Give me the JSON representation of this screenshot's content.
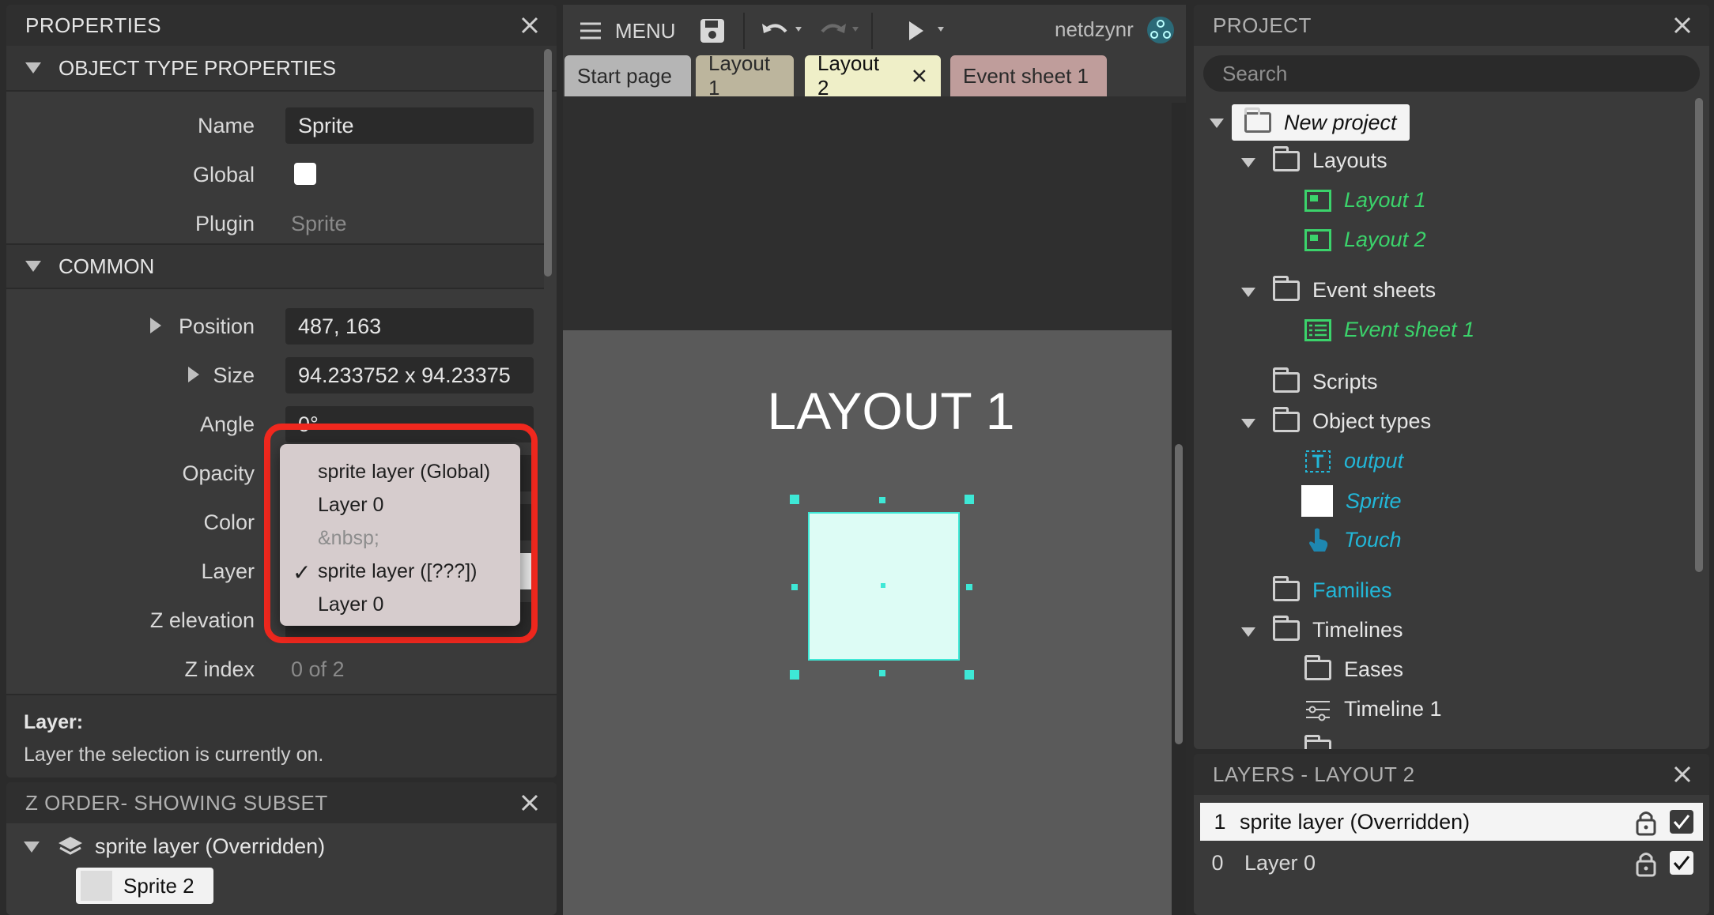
{
  "properties": {
    "title": "PROPERTIES",
    "object_type_section": "OBJECT TYPE PROPERTIES",
    "name_label": "Name",
    "name_value": "Sprite",
    "global_label": "Global",
    "plugin_label": "Plugin",
    "plugin_value": "Sprite",
    "common_section": "COMMON",
    "position_label": "Position",
    "position_value": "487, 163",
    "size_label": "Size",
    "size_value": "94.233752 x 94.23375",
    "angle_label": "Angle",
    "angle_value": "0°",
    "opacity_label": "Opacity",
    "color_label": "Color",
    "layer_label": "Layer",
    "z_elevation_label": "Z elevation",
    "z_index_label": "Z index",
    "z_index_value": "0 of 2",
    "desc_title": "Layer:",
    "desc_text": "Layer the selection is currently on."
  },
  "layer_dropdown": {
    "options": [
      {
        "label": "sprite layer (Global)",
        "checked": false,
        "disabled": false
      },
      {
        "label": "Layer 0",
        "checked": false,
        "disabled": false
      },
      {
        "label": "&nbsp;",
        "checked": false,
        "disabled": true
      },
      {
        "label": "sprite layer ([???])",
        "checked": true,
        "disabled": false
      },
      {
        "label": "Layer 0",
        "checked": false,
        "disabled": false
      }
    ],
    "check_mark": "✓"
  },
  "zorder": {
    "title": "Z ORDER- SHOWING SUBSET",
    "layer_name": "sprite layer (Overridden)",
    "sprite_name": "Sprite 2"
  },
  "toolbar": {
    "menu_label": "MENU",
    "username": "netdzynr"
  },
  "tabs": [
    {
      "label": "Start page",
      "active": false
    },
    {
      "label": "Layout 1",
      "active": false
    },
    {
      "label": "Layout 2",
      "active": true
    },
    {
      "label": "Event sheet 1",
      "active": false
    }
  ],
  "canvas": {
    "layout_title": "LAYOUT 1"
  },
  "project": {
    "title": "PROJECT",
    "search_placeholder": "Search",
    "root": "New project",
    "layouts_folder": "Layouts",
    "layout_1": "Layout 1",
    "layout_2": "Layout 2",
    "event_sheets_folder": "Event sheets",
    "event_sheet_1": "Event sheet 1",
    "scripts_folder": "Scripts",
    "object_types_folder": "Object types",
    "object_output": "output",
    "object_sprite": "Sprite",
    "object_touch": "Touch",
    "families_folder": "Families",
    "timelines_folder": "Timelines",
    "eases_folder": "Eases",
    "timeline_1": "Timeline 1"
  },
  "layers": {
    "title": "LAYERS - LAYOUT 2",
    "rows": [
      {
        "index": "1",
        "name": "sprite layer (Overridden)",
        "selected": true
      },
      {
        "index": "0",
        "name": "Layer 0",
        "selected": false
      }
    ]
  },
  "colors": {
    "accent_teal": "#3ee8d6",
    "highlight_red": "#f0281e",
    "layout_green": "#3bd36b",
    "object_blue": "#22b7d8"
  }
}
